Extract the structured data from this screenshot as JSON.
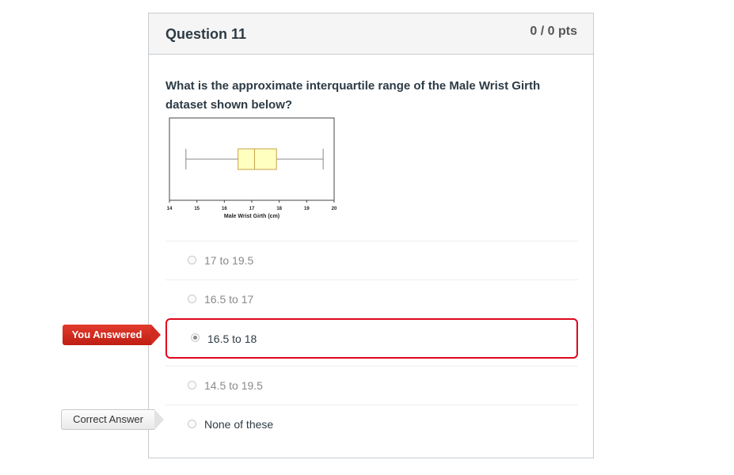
{
  "question": {
    "title": "Question 11",
    "points": "0 / 0 pts",
    "text": "What is the approximate interquartile range of the Male Wrist Girth dataset shown below?"
  },
  "chart_data": {
    "type": "boxplot",
    "xlabel": "Male Wrist Girth (cm)",
    "ticks": [
      14,
      15,
      16,
      17,
      18,
      19,
      20
    ],
    "xlim": [
      14,
      20
    ],
    "box": {
      "min": 14.6,
      "q1": 16.5,
      "median": 17.1,
      "q3": 17.9,
      "max": 19.6
    },
    "box_color": "#ffffc0"
  },
  "answers": [
    {
      "label": "17 to 19.5",
      "state": "unselected"
    },
    {
      "label": "16.5 to 17",
      "state": "unselected"
    },
    {
      "label": "16.5 to 18",
      "state": "selected"
    },
    {
      "label": "14.5 to 19.5",
      "state": "unselected"
    },
    {
      "label": "None of these",
      "state": "correct"
    }
  ],
  "flags": {
    "you_answered": "You Answered",
    "correct_answer": "Correct Answer"
  },
  "colors": {
    "accent_wrong": "#e0061f",
    "header_bg": "#f5f5f5"
  }
}
